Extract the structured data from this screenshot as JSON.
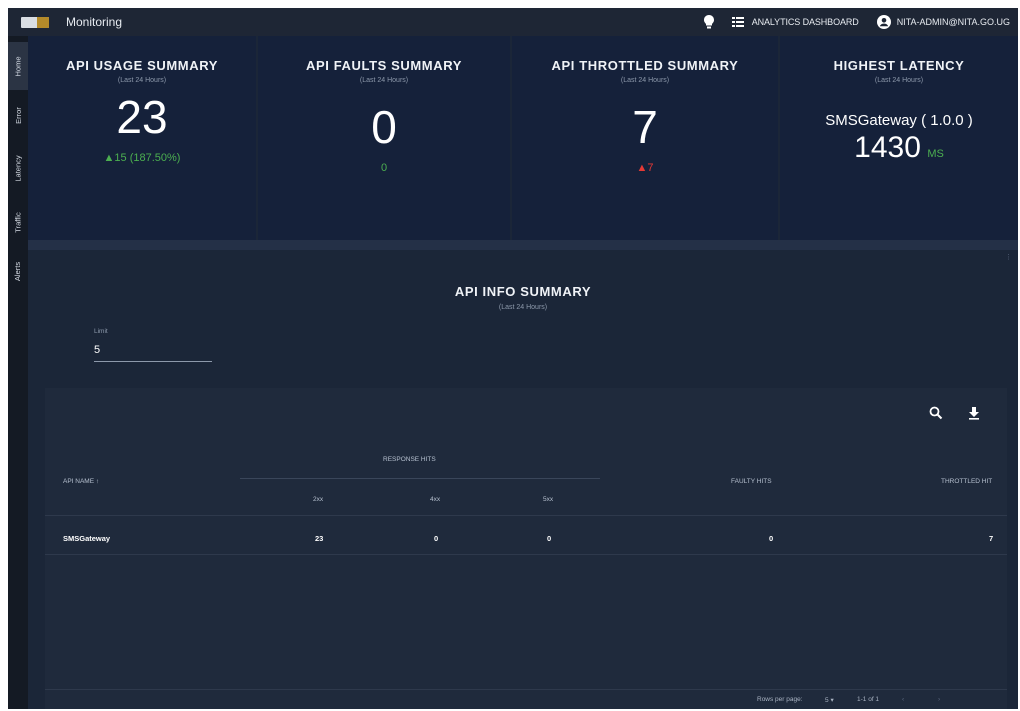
{
  "topbar": {
    "title": "Monitoring",
    "dashboard_label": "ANALYTICS DASHBOARD",
    "user_label": "NITA-ADMIN@NITA.GO.UG",
    "icons": [
      "lightbulb-icon",
      "grid-icon",
      "account-circle-icon"
    ]
  },
  "sidebar": {
    "items": [
      {
        "label": "Home"
      },
      {
        "label": "Error"
      },
      {
        "label": "Latency"
      },
      {
        "label": "Traffic"
      },
      {
        "label": "Alerts"
      }
    ]
  },
  "cards": {
    "usage": {
      "title": "API USAGE SUMMARY",
      "subtitle": "(Last 24 Hours)",
      "value": "23",
      "delta": "▲15 (187.50%)"
    },
    "faults": {
      "title": "API FAULTS SUMMARY",
      "subtitle": "(Last 24 Hours)",
      "value": "0",
      "delta": "0"
    },
    "throttled": {
      "title": "API THROTTLED SUMMARY",
      "subtitle": "(Last 24 Hours)",
      "value": "7",
      "delta": "▲7"
    },
    "latency": {
      "title": "HIGHEST LATENCY",
      "subtitle": "(Last 24 Hours)",
      "api": "SMSGateway ( 1.0.0 )",
      "value": "1430",
      "unit": "MS"
    }
  },
  "info": {
    "title": "API INFO SUMMARY",
    "subtitle": "(Last 24 Hours)",
    "limit_label": "Limit",
    "limit_value": "5"
  },
  "table": {
    "headers": {
      "api_name": "API NAME",
      "response_hits": "RESPONSE HITS",
      "c2xx": "2xx",
      "c4xx": "4xx",
      "c5xx": "5xx",
      "faulty": "FAULTY HITS",
      "throttled": "THROTTLED HIT"
    },
    "rows": [
      {
        "api": "SMSGateway",
        "c2xx": "23",
        "c4xx": "0",
        "c5xx": "0",
        "faulty": "0",
        "throttled": "7"
      }
    ],
    "footer": {
      "rows_per_page_label": "Rows per page:",
      "rows_per_page": "5",
      "range": "1-1 of 1"
    }
  },
  "colors": {
    "background": "#1b2638",
    "card": "#15213a",
    "up": "#4caf50",
    "down": "#e53935"
  }
}
